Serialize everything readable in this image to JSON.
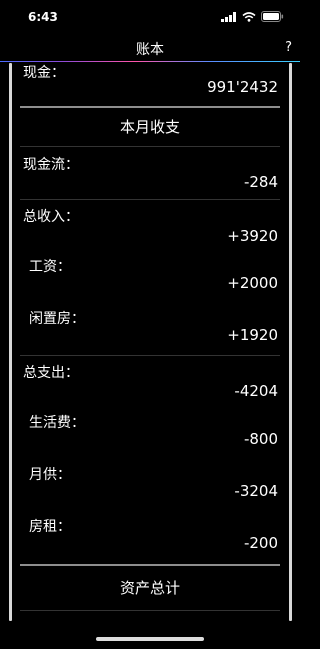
{
  "status_bar": {
    "time": "6:43"
  },
  "nav": {
    "title": "账本",
    "help_label": "?"
  },
  "cash": {
    "label": "现金：",
    "value": "991'2432"
  },
  "monthly": {
    "title": "本月收支",
    "cash_flow": {
      "label": "现金流：",
      "value": "-284"
    },
    "income": {
      "label": "总收入：",
      "value": "+3920",
      "items": [
        {
          "label": "工资：",
          "value": "+2000"
        },
        {
          "label": "闲置房：",
          "value": "+1920"
        }
      ]
    },
    "expense": {
      "label": "总支出：",
      "value": "-4204",
      "items": [
        {
          "label": "生活费：",
          "value": "-800"
        },
        {
          "label": "月供：",
          "value": "-3204"
        },
        {
          "label": "房租：",
          "value": "-200"
        }
      ]
    }
  },
  "assets": {
    "title": "资产总计"
  }
}
